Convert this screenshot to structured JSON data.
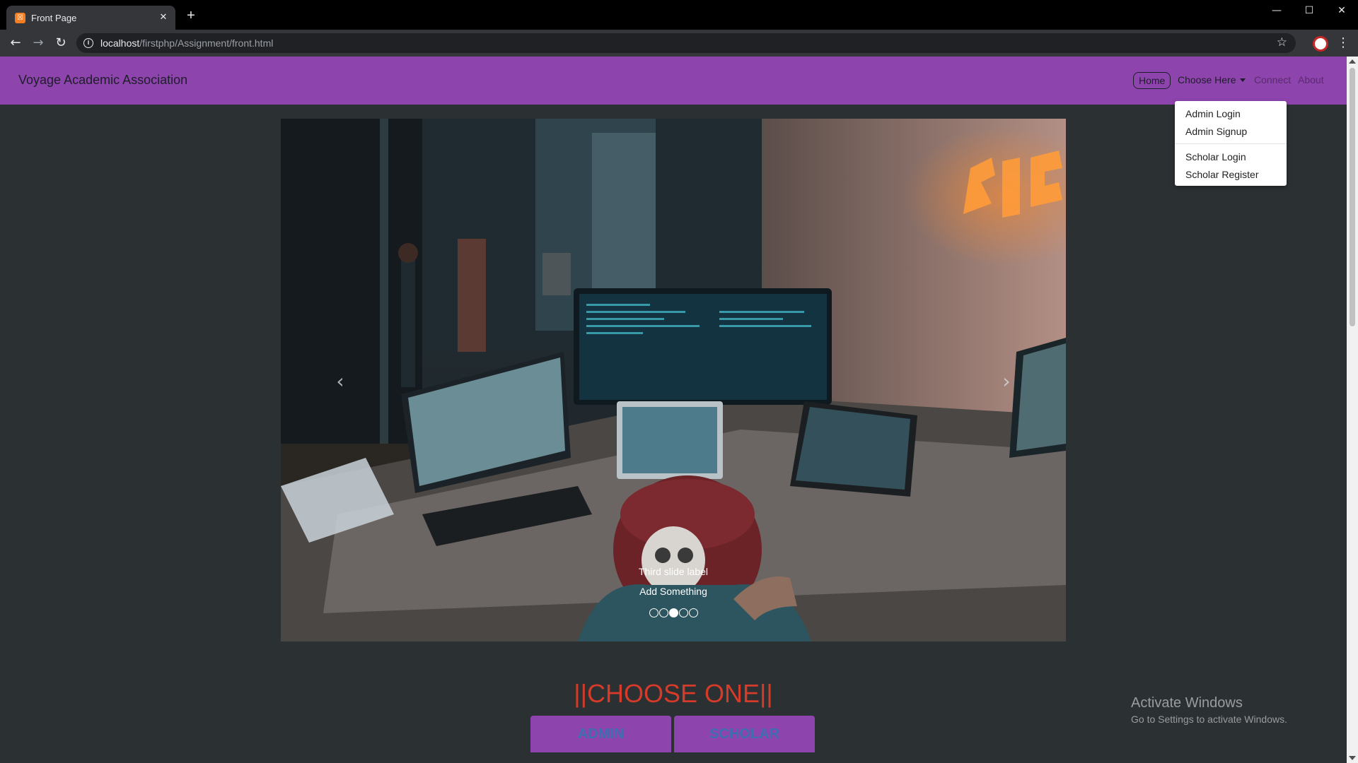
{
  "browser": {
    "tab_title": "Front Page",
    "tab_close": "✕",
    "new_tab": "+",
    "url_host": "localhost",
    "url_path": "/firstphp/Assignment/front.html",
    "back": "←",
    "forward": "→",
    "reload": "↻",
    "minimize": "—",
    "maximize": "☐",
    "close": "✕",
    "star": "☆",
    "menu": "⋮"
  },
  "navbar": {
    "brand": "Voyage Academic Association",
    "home": "Home",
    "choose": "Choose Here",
    "connect": "Connect",
    "about": "About",
    "bg_color": "#8e44ad"
  },
  "dropdown": {
    "items": [
      "Admin Login",
      "Admin Signup",
      "Scholar Login",
      "Scholar Register"
    ]
  },
  "carousel": {
    "caption_title": "Third slide label",
    "caption_text": "Add Something",
    "prev": "‹",
    "next": "›",
    "slide_count": 5,
    "active_index": 2
  },
  "choose": {
    "title": "||CHOOSE ONE||",
    "admin": "ADMIN",
    "scholar": "SCHOLAR",
    "title_color": "#d63a28"
  },
  "watermark": {
    "title": "Activate Windows",
    "subtitle": "Go to Settings to activate Windows."
  }
}
